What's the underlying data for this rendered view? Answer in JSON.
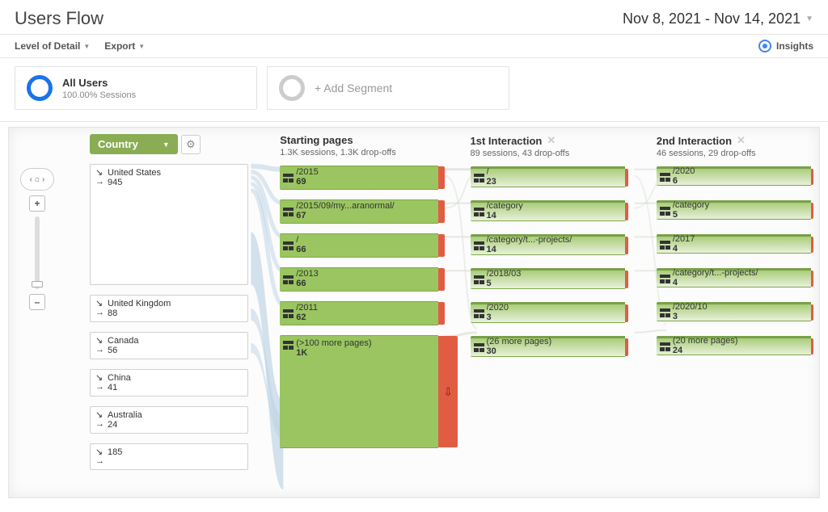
{
  "header": {
    "title": "Users Flow",
    "date_range": "Nov 8, 2021 - Nov 14, 2021"
  },
  "subbar": {
    "level_detail": "Level of Detail",
    "export": "Export",
    "insights": "Insights"
  },
  "segments": {
    "all_users": "All Users",
    "all_users_sub": "100.00% Sessions",
    "add": "+ Add Segment"
  },
  "flow": {
    "dimension": "Country",
    "sources": [
      {
        "label": "United States",
        "value": "945"
      },
      {
        "label": "United Kingdom",
        "value": "88"
      },
      {
        "label": "Canada",
        "value": "56"
      },
      {
        "label": "China",
        "value": "41"
      },
      {
        "label": "Australia",
        "value": "24"
      },
      {
        "label": "",
        "value": "185"
      }
    ],
    "columns": [
      {
        "title": "Starting pages",
        "sub": "1.3K sessions, 1.3K drop-offs",
        "nodes": [
          {
            "label": "/2015",
            "value": "69"
          },
          {
            "label": "/2015/09/my...aranormal/",
            "value": "67"
          },
          {
            "label": "/",
            "value": "66"
          },
          {
            "label": "/2013",
            "value": "66"
          },
          {
            "label": "/2011",
            "value": "62"
          },
          {
            "label": "(>100 more pages)",
            "value": "1K"
          }
        ]
      },
      {
        "title": "1st Interaction",
        "sub": "89 sessions, 43 drop-offs",
        "nodes": [
          {
            "label": "/",
            "value": "23"
          },
          {
            "label": "/category",
            "value": "14"
          },
          {
            "label": "/category/t...-projects/",
            "value": "14"
          },
          {
            "label": "/2018/03",
            "value": "5"
          },
          {
            "label": "/2020",
            "value": "3"
          },
          {
            "label": "(26 more pages)",
            "value": "30"
          }
        ]
      },
      {
        "title": "2nd Interaction",
        "sub": "46 sessions, 29 drop-offs",
        "nodes": [
          {
            "label": "/2020",
            "value": "6"
          },
          {
            "label": "/category",
            "value": "5"
          },
          {
            "label": "/2017",
            "value": "4"
          },
          {
            "label": "/category/t...-projects/",
            "value": "4"
          },
          {
            "label": "/2020/10",
            "value": "3"
          },
          {
            "label": "(20 more pages)",
            "value": "24"
          }
        ]
      }
    ]
  },
  "zoom": {
    "plus": "+",
    "minus": "–",
    "home": "⌂"
  }
}
